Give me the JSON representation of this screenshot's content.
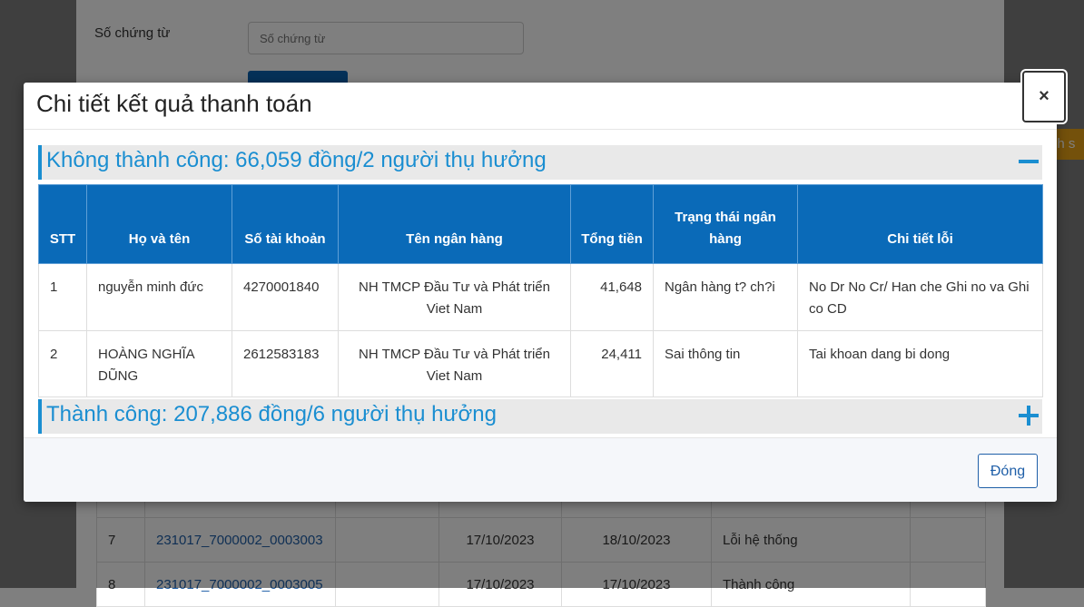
{
  "background": {
    "filter_label": "Số chứng từ",
    "filter_placeholder": "Số chứng từ",
    "side_tab_label": "nh s",
    "rows": [
      {
        "stt": "7",
        "code": "231017_7000002_0003003",
        "date1": "17/10/2023",
        "date2": "18/10/2023",
        "status": "Lỗi hệ thống"
      },
      {
        "stt": "8",
        "code": "231017_7000002_0003005",
        "date1": "17/10/2023",
        "date2": "17/10/2023",
        "status": "Thành công"
      }
    ]
  },
  "modal": {
    "title": "Chi tiết kết quả thanh toán",
    "close_symbol": "×",
    "failed_section": {
      "title": "Không thành công: 66,059 đồng/2 người thụ hưởng",
      "expanded": true
    },
    "success_section": {
      "title": "Thành công: 207,886 đồng/6 người thụ hưởng",
      "expanded": false
    },
    "table": {
      "headers": [
        "STT",
        "Họ và tên",
        "Số tài khoản",
        "Tên ngân hàng",
        "Tổng tiền",
        "Trạng thái ngân hàng",
        "Chi tiết lỗi"
      ],
      "rows": [
        {
          "stt": "1",
          "name": "nguyễn minh đức",
          "account": "4270001840",
          "bank": "NH TMCP Đầu Tư và Phát triển Viet Nam",
          "amount": "41,648",
          "bank_status": "Ngân hàng t? ch?i",
          "error": "No Dr No Cr/ Han che Ghi no va Ghi co CD"
        },
        {
          "stt": "2",
          "name": "HOÀNG NGHĨA DŨNG",
          "account": "2612583183",
          "bank": "NH TMCP Đầu Tư và Phát triển Viet Nam",
          "amount": "24,411",
          "bank_status": "Sai thông tin",
          "error": "Tai khoan dang bi dong"
        }
      ]
    },
    "footer_close_label": "Đóng"
  },
  "colors": {
    "accent": "#1a8ed1",
    "table_header": "#0a6ab8",
    "section_bg": "#e9e9e9"
  }
}
